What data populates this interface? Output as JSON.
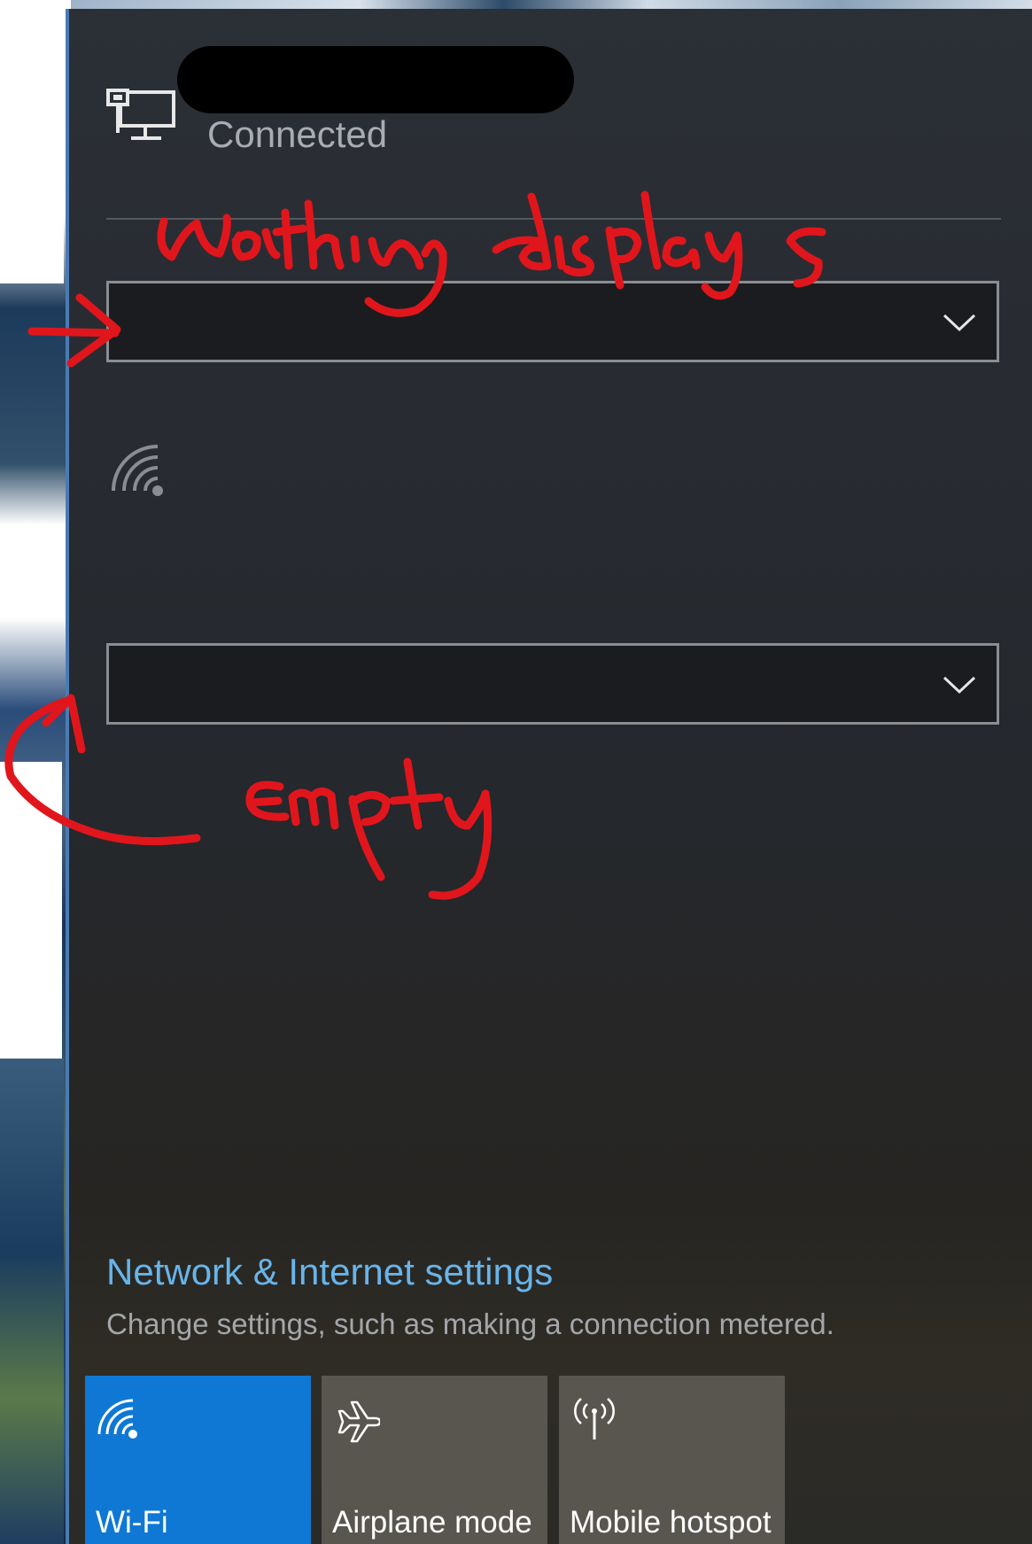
{
  "network": {
    "icon": "ethernet-icon",
    "name": "",
    "status": "Connected"
  },
  "dropdowns": [
    {
      "selected": "",
      "icon": "chevron-down-icon"
    },
    {
      "selected": "",
      "icon": "chevron-down-icon"
    }
  ],
  "wifi_signal_icon": "wifi-icon",
  "settings": {
    "link": "Network & Internet settings",
    "description": "Change settings, such as making a connection metered."
  },
  "quick_actions": [
    {
      "label": "Wi-Fi",
      "icon": "wifi-icon",
      "active": true,
      "color": "#0f78d4"
    },
    {
      "label": "Airplane mode",
      "icon": "airplane-icon",
      "active": false,
      "color": "#595650"
    },
    {
      "label": "Mobile hotspot",
      "icon": "hotspot-icon",
      "active": false,
      "color": "#595650"
    }
  ],
  "annotations": {
    "note_1": "Nothing displays",
    "note_2": "Empty",
    "color": "#e0161c"
  },
  "accent_color": "#68b4ea"
}
